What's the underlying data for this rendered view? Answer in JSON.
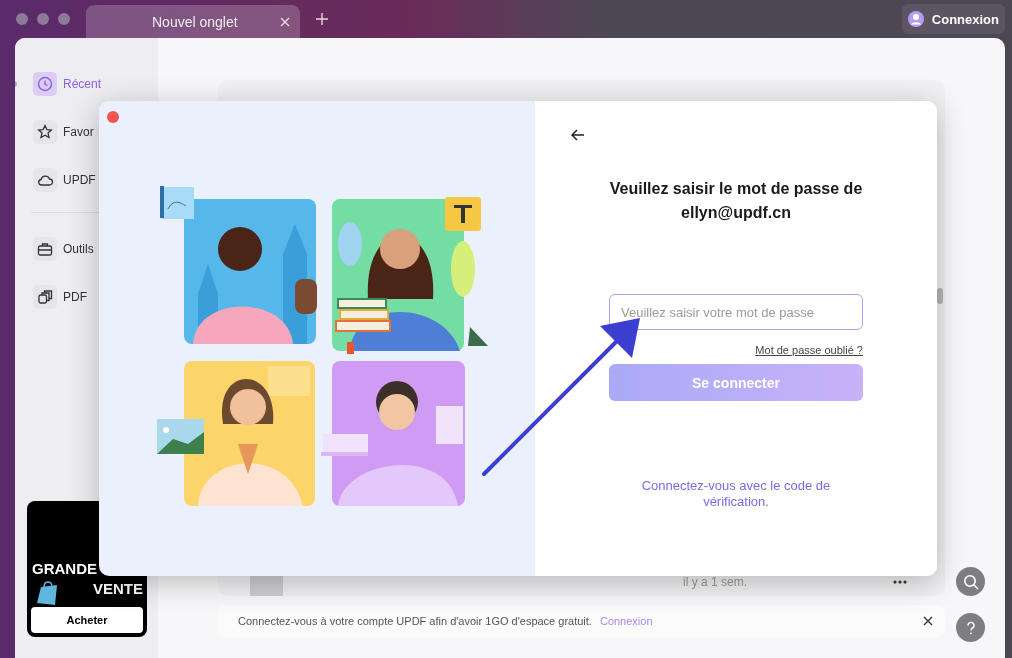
{
  "window": {
    "tabs": [
      {
        "label": "Nouvel onglet",
        "selected": true
      }
    ],
    "account_button": "Connexion"
  },
  "sidebar": {
    "groups": [
      [
        {
          "label": "Récent",
          "selected": true
        },
        {
          "label": "Favor",
          "selected": false
        },
        {
          "label": "UPDF",
          "selected": false
        }
      ],
      [
        {
          "label": "Outils",
          "selected": false
        },
        {
          "label": "PDF",
          "selected": false
        }
      ]
    ]
  },
  "promo": {
    "title_lines": [
      "GRANDE",
      "VENTE"
    ],
    "button": "Acheter"
  },
  "file_row": {
    "time": "il y a 1 sem."
  },
  "notice": {
    "text": "Connectez-vous à votre compte UPDF afin d'avoir 1GO d'espace gratuit.",
    "link": "Connexion"
  },
  "dialog": {
    "title": "Veuillez saisir le mot de passe de ellyn@updf.cn",
    "password": {
      "placeholder": "Veuillez saisir votre mot de passe"
    },
    "forgot_link": "Mot de passe oublié ?",
    "submit": {
      "label": "Se connecter",
      "disabled": true
    },
    "code_link": "Connectez-vous avec le code de vérification."
  }
}
